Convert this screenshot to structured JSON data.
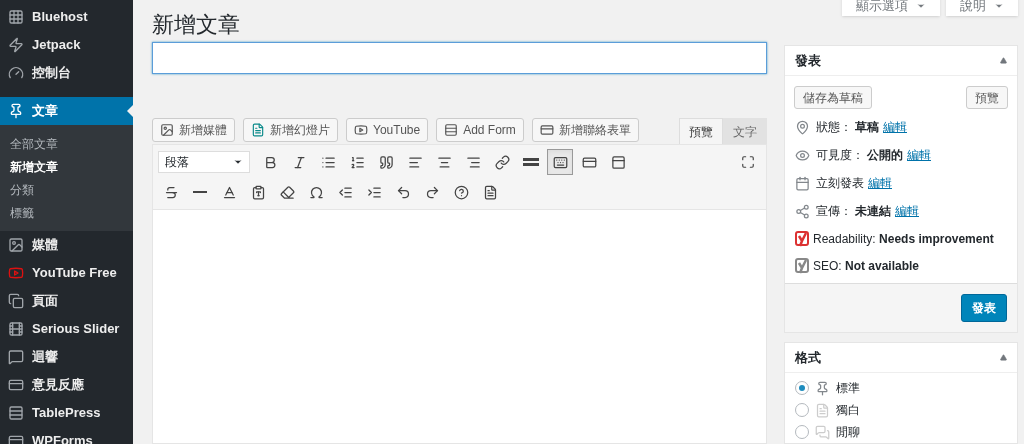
{
  "sidebar": {
    "items": [
      {
        "kind": "grid",
        "label": "Bluehost",
        "selected": false
      },
      {
        "kind": "bolt",
        "label": "Jetpack",
        "selected": false
      },
      {
        "kind": "gauge",
        "label": "控制台",
        "selected": false
      },
      {
        "kind": "pin",
        "label": "文章",
        "selected": true,
        "children": [
          {
            "label": "全部文章",
            "selected": false
          },
          {
            "label": "新增文章",
            "selected": true
          },
          {
            "label": "分類",
            "selected": false
          },
          {
            "label": "標籤",
            "selected": false
          }
        ]
      },
      {
        "kind": "media",
        "label": "媒體",
        "selected": false
      },
      {
        "kind": "youtube",
        "label": "YouTube Free",
        "selected": false
      },
      {
        "kind": "pages",
        "label": "頁面",
        "selected": false
      },
      {
        "kind": "slider",
        "label": "Serious Slider",
        "selected": false
      },
      {
        "kind": "comment",
        "label": "迴響",
        "selected": false
      },
      {
        "kind": "form",
        "label": "意見反應",
        "selected": false
      },
      {
        "kind": "table",
        "label": "TablePress",
        "selected": false
      },
      {
        "kind": "form",
        "label": "WPForms",
        "selected": false
      }
    ]
  },
  "header": {
    "title": "新增文章",
    "buttons": [
      "顯示選項",
      "說明"
    ]
  },
  "media_buttons": [
    {
      "kind": "media",
      "label": "新增媒體"
    },
    {
      "kind": "slide",
      "label": "新增幻燈片"
    },
    {
      "kind": "youtube",
      "label": "YouTube"
    },
    {
      "kind": "form",
      "label": "Add Form"
    },
    {
      "kind": "contact",
      "label": "新增聯絡表單"
    }
  ],
  "editor_tabs": [
    {
      "label": "預覽",
      "selected": true
    },
    {
      "label": "文字",
      "selected": false
    }
  ],
  "format_select": {
    "value": "段落"
  },
  "toolbar_rows": [
    [
      {
        "kind": "bold",
        "active": false
      },
      {
        "kind": "italic",
        "active": false
      },
      {
        "kind": "bullets",
        "active": false
      },
      {
        "kind": "numbers",
        "active": false
      },
      {
        "kind": "quote",
        "active": false
      },
      {
        "kind": "align-left",
        "active": false
      },
      {
        "kind": "align-center",
        "active": false
      },
      {
        "kind": "align-right",
        "active": false
      },
      {
        "kind": "link",
        "active": false
      },
      {
        "kind": "more",
        "active": false
      },
      {
        "kind": "toolbar-toggle",
        "active": true
      },
      {
        "kind": "form",
        "active": false
      },
      {
        "kind": "shortcode",
        "active": false
      }
    ],
    [
      {
        "kind": "strike",
        "active": false
      },
      {
        "kind": "hr",
        "active": false
      },
      {
        "kind": "color",
        "active": false
      },
      {
        "kind": "paste",
        "active": false
      },
      {
        "kind": "eraser",
        "active": false
      },
      {
        "kind": "omega",
        "active": false
      },
      {
        "kind": "outdent",
        "active": false
      },
      {
        "kind": "indent",
        "active": false
      },
      {
        "kind": "undo",
        "active": false
      },
      {
        "kind": "redo",
        "active": false
      },
      {
        "kind": "help",
        "active": false
      },
      {
        "kind": "slide",
        "active": false
      }
    ]
  ],
  "publish_box": {
    "title": "發表",
    "save_button": "儲存為草稿",
    "preview_button": "預覽",
    "rows": [
      {
        "kind": "status",
        "label": "狀態： ",
        "value": "草稿",
        "link": "編輯"
      },
      {
        "kind": "visibility",
        "label": "可見度： ",
        "value": "公開的",
        "link": "編輯"
      },
      {
        "kind": "schedule",
        "label": "立刻發表",
        "link": "編輯"
      },
      {
        "kind": "share",
        "label": "宣傳： ",
        "value": "未連結",
        "link": "編輯"
      }
    ],
    "seo_rows": [
      {
        "text": "Readability: **Needs improvement**",
        "color": "#dc3232"
      },
      {
        "text": "SEO: **Not available**",
        "color": "#888888"
      }
    ],
    "publish_button": "發表"
  },
  "format_box": {
    "title": "格式",
    "options": [
      {
        "kind": "standard",
        "label": "標準",
        "selected": true
      },
      {
        "kind": "aside",
        "label": "獨白",
        "selected": false
      },
      {
        "kind": "chat",
        "label": "閒聊",
        "selected": false
      }
    ]
  }
}
